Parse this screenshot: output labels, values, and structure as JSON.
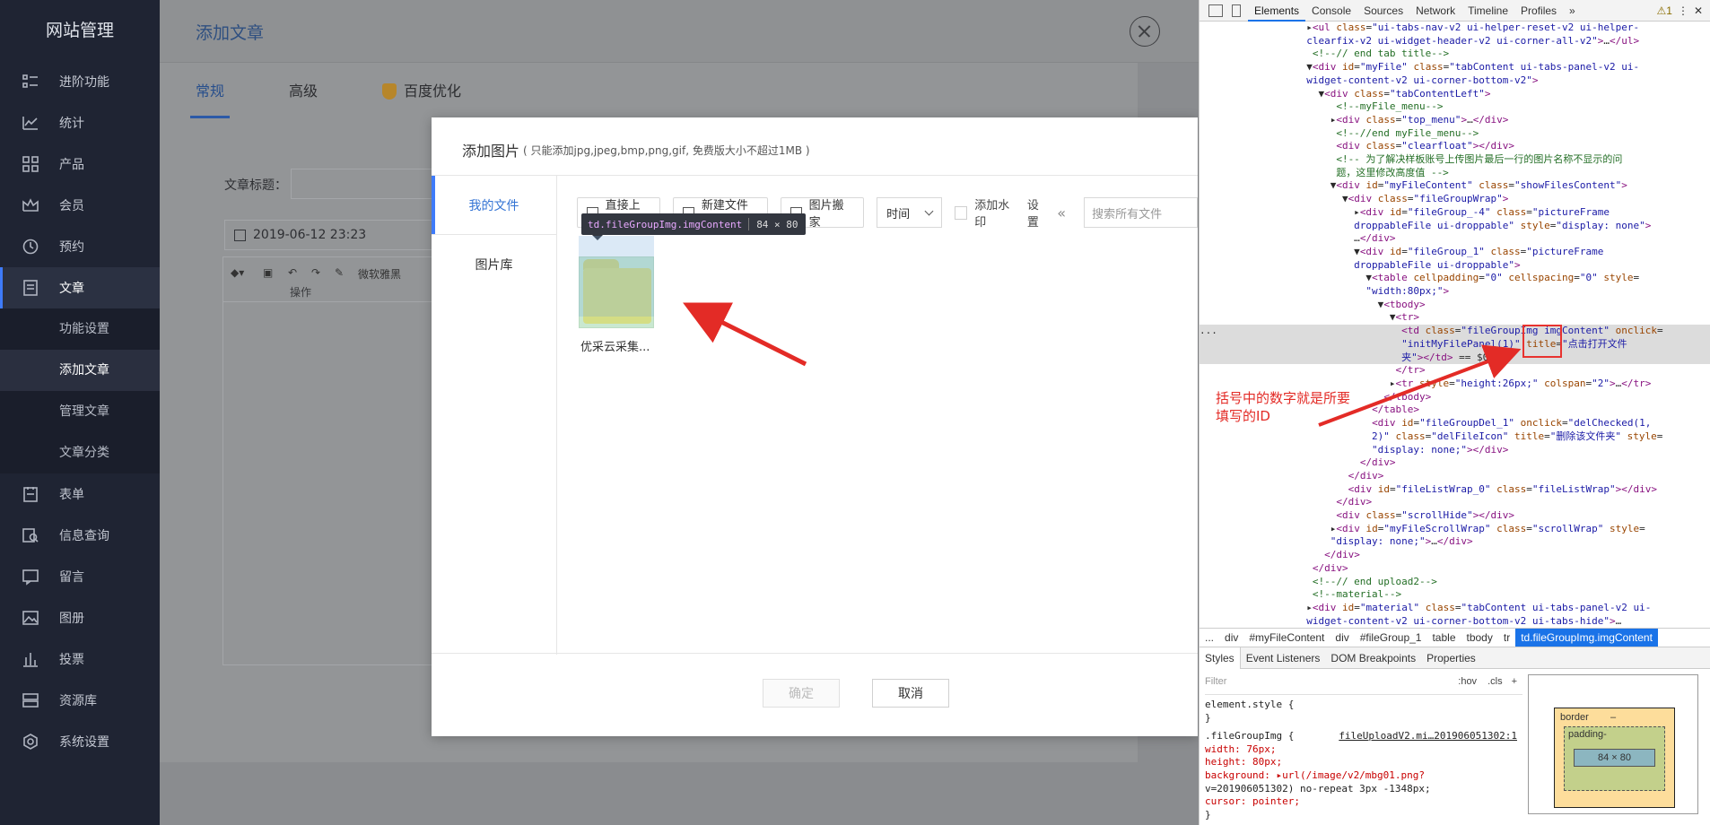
{
  "sidebar": {
    "title": "网站管理",
    "items": [
      {
        "label": "进阶功能",
        "icon": "list-icon"
      },
      {
        "label": "统计",
        "icon": "chart-icon"
      },
      {
        "label": "产品",
        "icon": "grid-icon"
      },
      {
        "label": "会员",
        "icon": "crown-icon"
      },
      {
        "label": "预约",
        "icon": "clock-icon"
      },
      {
        "label": "文章",
        "icon": "article-icon"
      }
    ],
    "sub_items": [
      "功能设置",
      "添加文章",
      "管理文章",
      "文章分类"
    ],
    "items_after": [
      {
        "label": "表单",
        "icon": "form-icon"
      },
      {
        "label": "信息查询",
        "icon": "search-doc-icon"
      },
      {
        "label": "留言",
        "icon": "message-icon"
      },
      {
        "label": "图册",
        "icon": "image-icon"
      },
      {
        "label": "投票",
        "icon": "bars-icon"
      },
      {
        "label": "资源库",
        "icon": "storage-icon"
      },
      {
        "label": "系统设置",
        "icon": "gear-icon"
      }
    ]
  },
  "page": {
    "title": "添加文章",
    "tabs": [
      "常规",
      "高级",
      "百度优化"
    ],
    "title_label": "文章标题：",
    "date": "2019-06-12 23:23",
    "editor_font": "微软雅黑",
    "editor_ops": "操作"
  },
  "modal": {
    "title": "添加图片",
    "hint": "( 只能添加jpg,jpeg,bmp,png,gif, 免费版大小不超过1MB )",
    "nav": [
      "我的文件",
      "图片库"
    ],
    "toolbar": {
      "upload": "直接上传",
      "new_folder": "新建文件夹",
      "move": "图片搬家",
      "sort": "时间",
      "watermark": "添加水印",
      "settings": "设置",
      "collapse": "«",
      "search_placeholder": "搜索所有文件"
    },
    "folder_name": "优采云采集...",
    "ok": "确定",
    "cancel": "取消"
  },
  "tooltip": {
    "selector": "td.fileGroupImg.imgContent",
    "size": "84 × 80"
  },
  "devtools": {
    "tabs": [
      "Elements",
      "Console",
      "Sources",
      "Network",
      "Timeline",
      "Profiles"
    ],
    "warn": "⚠1",
    "breadcrumbs": [
      "...",
      "div",
      "#myFileContent",
      "div",
      "#fileGroup_1",
      "table",
      "tbody",
      "tr",
      "td.fileGroupImg.imgContent"
    ],
    "subtabs": [
      "Styles",
      "Event Listeners",
      "DOM Breakpoints",
      "Properties"
    ],
    "filter": "Filter",
    "hov": ":hov",
    "cls": ".cls",
    "css_lines": [
      "element.style {",
      "}",
      ".fileGroupImg {",
      "  width: 76px;",
      "  height: 80px;",
      "  background: ▸url(/image/v2/mbg01.png?",
      "      v=201906051302) no-repeat 3px -1348px;",
      "  cursor: pointer;",
      "}"
    ],
    "css_source": "fileUploadV2.mi…201906051302:1",
    "box": {
      "border": "border",
      "padding": "padding-",
      "content": "84 × 80",
      "dash": "–"
    }
  },
  "annotation": "括号中的数字就是所要填写的ID",
  "colors": {
    "accent": "#3e7bfa",
    "annotation": "#e32b26"
  }
}
